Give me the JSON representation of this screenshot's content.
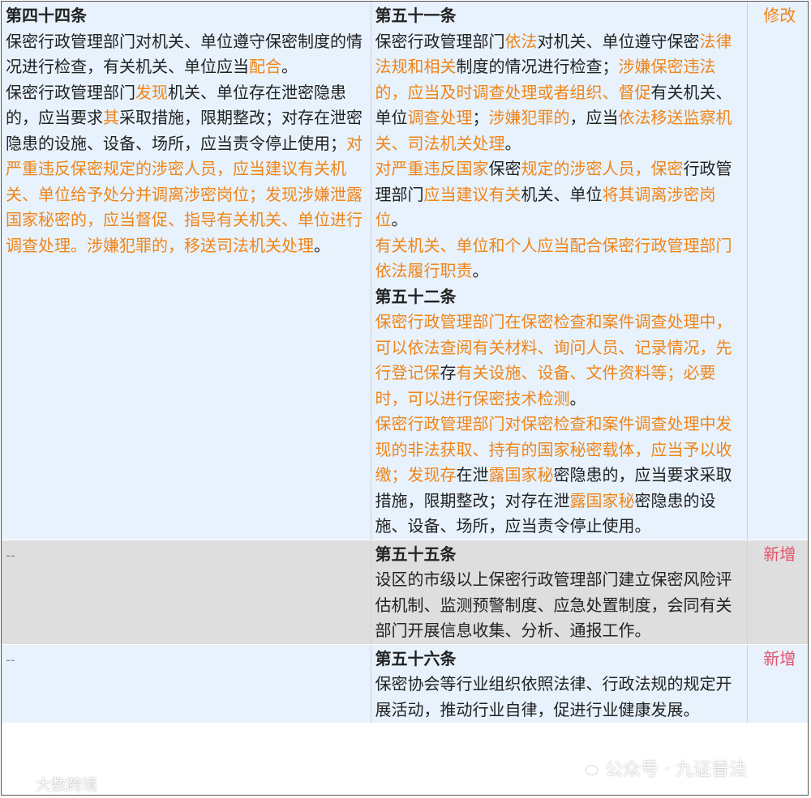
{
  "rows": [
    {
      "left": {
        "title": "第四十四条",
        "paras": [
          [
            {
              "t": "保密行政管理部门对机关、单位遵守保密制度的情况进行检查，有关机关、单位应当"
            },
            {
              "t": "配合",
              "h": true
            },
            {
              "t": "。"
            }
          ],
          [
            {
              "t": "保密行政管理部门"
            },
            {
              "t": "发现",
              "h": true
            },
            {
              "t": "机关、单位存在泄密隐患的，应当要求"
            },
            {
              "t": "其",
              "h": true
            },
            {
              "t": "采取措施，限期整改；对存在泄密隐患的设施、设备、场所，应当责令停止使用；"
            },
            {
              "t": "对严重违反保密规定的涉密人员，应当建议有关机关、单位给予处分并调离涉密岗位；发现涉嫌泄露国家秘密的，应当督促、指导有关机关、单位进行调查处理。涉嫌犯罪的，移送司法机关处理",
              "h": true
            },
            {
              "t": "。"
            }
          ]
        ]
      },
      "right": [
        {
          "title": "第五十一条",
          "paras": [
            [
              {
                "t": "保密行政管理部门"
              },
              {
                "t": "依法",
                "h": true
              },
              {
                "t": "对机关、单位遵守保密"
              },
              {
                "t": "法律法规和相关",
                "h": true
              },
              {
                "t": "制度的情况进行检查；"
              },
              {
                "t": "涉嫌保密违法的，应当及时调查处理或者组织、督促",
                "h": true
              },
              {
                "t": "有关机关、单位"
              },
              {
                "t": "调查处理",
                "h": true
              },
              {
                "t": "；"
              },
              {
                "t": "涉嫌犯罪的",
                "h": true
              },
              {
                "t": "，应当"
              },
              {
                "t": "依法移送监察机关、司法机关处理",
                "h": true
              },
              {
                "t": "。"
              }
            ],
            [
              {
                "t": "对严重违反国家",
                "h": true
              },
              {
                "t": "保密"
              },
              {
                "t": "规定的涉密人员，",
                "h": true
              },
              {
                "t": "保密",
                "h": true
              },
              {
                "t": "行政管理部门"
              },
              {
                "t": "应当建议有关",
                "h": true
              },
              {
                "t": "机关、单位"
              },
              {
                "t": "将其调离涉密岗位",
                "h": true
              },
              {
                "t": "。"
              }
            ],
            [
              {
                "t": "有关机关、单位和个人应当配合保密行政管理部门依法履行职责",
                "h": true
              },
              {
                "t": "。"
              }
            ]
          ]
        },
        {
          "title": "第五十二条",
          "paras": [
            [
              {
                "t": "保密行政管理部门在保密检查和案件调查处理中，可以依法查阅有关材料、询问人员、记录情况，先行登记保",
                "h": true
              },
              {
                "t": "存"
              },
              {
                "t": "有关设施、设备、文件资料等；必要时，可以进行保密技术检测",
                "h": true
              },
              {
                "t": "。"
              }
            ],
            [
              {
                "t": "保密行政管理部门对保密检查和案件调查处理中发现的非法获取、持有的国家秘密载体，应当予以收缴；发现存",
                "h": true
              },
              {
                "t": "在泄"
              },
              {
                "t": "露国家秘",
                "h": true
              },
              {
                "t": "密隐患的，应当要求采取措施，限期整改；对存在泄"
              },
              {
                "t": "露国家秘",
                "h": true
              },
              {
                "t": "密隐患的设施、设备、场所，应当责令停止使用。"
              }
            ]
          ]
        }
      ],
      "tag": "修改",
      "tag_type": "mod",
      "style": "blue"
    },
    {
      "left_empty": "--",
      "right": [
        {
          "title": "第五十五条",
          "paras": [
            [
              {
                "t": "设区的市级以上保密行政管理部门建立保密风险评估机制、监测预警制度、应急处置制度，会同有关部门开展信息收集、分析、通报工作。"
              }
            ]
          ]
        }
      ],
      "tag": "新增",
      "tag_type": "new",
      "style": "gray"
    },
    {
      "left_empty": "--",
      "right": [
        {
          "title": "第五十六条",
          "paras": [
            [
              {
                "t": "保密协会等行业组织依照法律、行政法规的规定开展活动，推动行业自律，促进行业健康发展。"
              }
            ]
          ]
        }
      ],
      "tag": "新增",
      "tag_type": "new",
      "style": "blue"
    }
  ],
  "watermark": {
    "left_text": "大数跨境",
    "right_text": "公众号 · 九证普法"
  },
  "colors": {
    "highlight": "#f08418",
    "tag_new": "#e2546b",
    "row_blue": "#e7f2fd",
    "row_gray": "#dedede"
  }
}
